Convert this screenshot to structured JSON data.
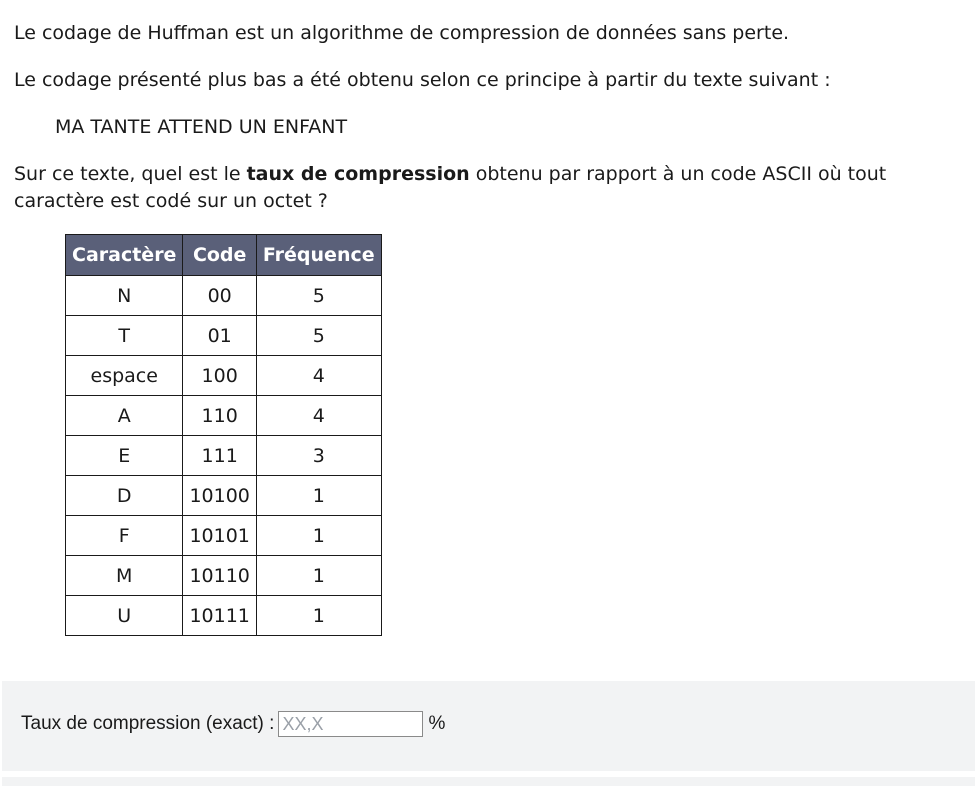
{
  "question": {
    "line1": "Le codage de Huffman est un algorithme de compression de données sans perte.",
    "line2": "Le codage présenté plus bas a été obtenu selon ce principe à partir du texte suivant :",
    "example_text": "MA TANTE ATTEND UN ENFANT",
    "line3_before": "Sur ce texte, quel est le ",
    "line3_bold": "taux de compression",
    "line3_after": " obtenu par rapport à un code ASCII où tout caractère est codé sur un octet ?"
  },
  "table": {
    "headers": [
      "Caractère",
      "Code",
      "Fréquence"
    ],
    "rows": [
      [
        "N",
        "00",
        "5"
      ],
      [
        "T",
        "01",
        "5"
      ],
      [
        "espace",
        "100",
        "4"
      ],
      [
        "A",
        "110",
        "4"
      ],
      [
        "E",
        "111",
        "3"
      ],
      [
        "D",
        "10100",
        "1"
      ],
      [
        "F",
        "10101",
        "1"
      ],
      [
        "M",
        "10110",
        "1"
      ],
      [
        "U",
        "10111",
        "1"
      ]
    ]
  },
  "answer": {
    "label": "Taux de compression (exact) :",
    "placeholder": "XX,X",
    "value": "",
    "unit": "%"
  },
  "colors": {
    "header_bg": "#5a6079",
    "panel_bg": "#f2f3f4"
  }
}
